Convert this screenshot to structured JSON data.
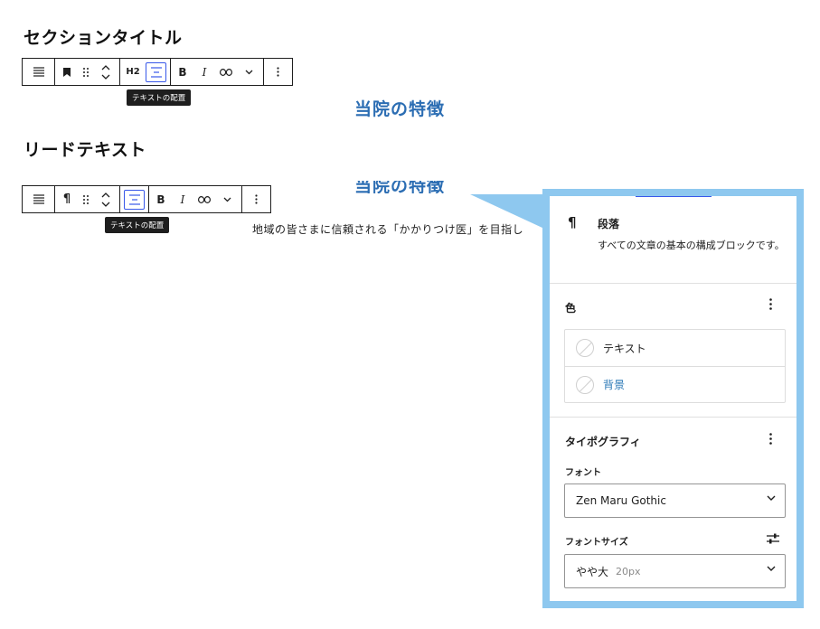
{
  "sections": {
    "section_title": "セクションタイトル",
    "lead_text": "リードテキスト"
  },
  "toolbar1": {
    "heading_level": "H2",
    "bold": "B",
    "italic": "I",
    "tooltip": "テキストの配置"
  },
  "toolbar2": {
    "paragraph_glyph": "¶",
    "bold": "B",
    "italic": "I",
    "tooltip": "テキストの配置"
  },
  "preview": {
    "heading": "当院の特徴",
    "heading_clipped": "当院の特徴",
    "lead_sentence": "地域の皆さまに信頼される「かかりつけ医」を目指し"
  },
  "sidebar": {
    "block": {
      "icon": "paragraph-icon",
      "glyph": "¶",
      "title": "段落",
      "description": "すべての文章の基本の構成ブロックです。"
    },
    "color": {
      "title": "色",
      "items": [
        {
          "label": "テキスト"
        },
        {
          "label": "背景"
        }
      ]
    },
    "typography": {
      "title": "タイポグラフィ",
      "font_label": "フォント",
      "font_value": "Zen Maru Gothic",
      "font_size_label": "フォントサイズ",
      "font_size_value": "やや大",
      "font_size_unit": "20px"
    }
  },
  "colors": {
    "accent": "#2b6db3",
    "callout": "#8ec8ef",
    "wp_blue": "#3858e9"
  }
}
